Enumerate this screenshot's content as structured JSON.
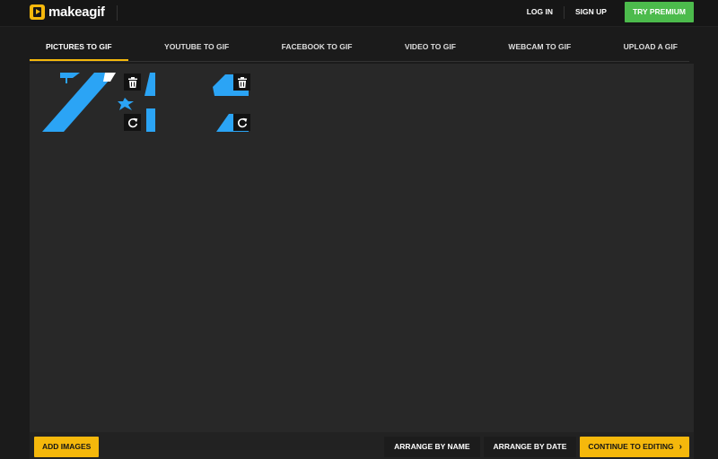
{
  "app": {
    "logo_text": "makeagif",
    "logo_icon": "play-logo-icon"
  },
  "header": {
    "login_label": "LOG IN",
    "signup_label": "SIGN UP",
    "premium_label": "TRY PREMIUM"
  },
  "tabs": [
    {
      "label": "PICTURES TO GIF",
      "active": true
    },
    {
      "label": "YOUTUBE TO GIF",
      "active": false
    },
    {
      "label": "FACEBOOK TO GIF",
      "active": false
    },
    {
      "label": "VIDEO TO GIF",
      "active": false
    },
    {
      "label": "WEBCAM TO GIF",
      "active": false
    },
    {
      "label": "UPLOAD A GIF",
      "active": false
    }
  ],
  "thumbnails": [
    {
      "delete_icon": "trash-icon",
      "rotate_icon": "rotate-icon",
      "move_icon": "move-icon"
    },
    {
      "delete_icon": "trash-icon",
      "rotate_icon": "rotate-icon"
    }
  ],
  "footer": {
    "add_images_label": "ADD IMAGES",
    "arrange_name_label": "ARRANGE BY NAME",
    "arrange_date_label": "ARRANGE BY DATE",
    "continue_label": "CONTINUE TO EDITING",
    "continue_icon": "chevron-right-icon"
  },
  "colors": {
    "accent": "#f5b80c",
    "premium": "#4cbb4c",
    "thumbnail_blue": "#2ba4f5",
    "background": "#1b1b1b",
    "workspace": "#282828"
  }
}
